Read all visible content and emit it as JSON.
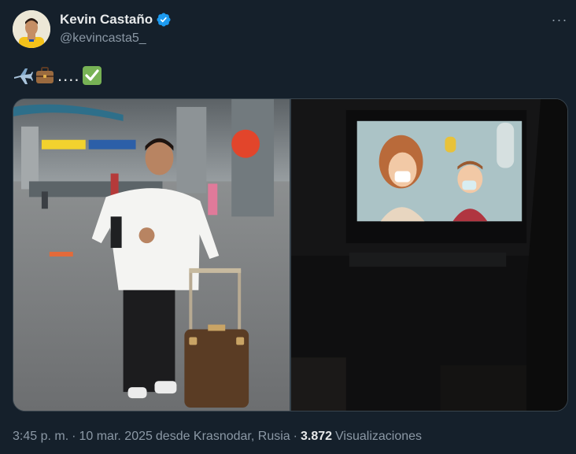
{
  "author": {
    "display_name": "Kevin Castaño",
    "handle": "@kevincasta5_",
    "verified": true,
    "avatar_icon": "avatar-photo"
  },
  "tweet": {
    "dots": "....",
    "emojis": [
      "airplane-emoji",
      "briefcase-emoji",
      "check-mark-emoji"
    ]
  },
  "media": [
    {
      "icon": "airport-photo"
    },
    {
      "icon": "in-flight-screen-photo"
    }
  ],
  "meta": {
    "time": "3:45 p. m.",
    "separator": "·",
    "date": "10 mar. 2025",
    "location_text": "desde Krasnodar, Rusia",
    "views_count": "3.872",
    "views_label": "Visualizaciones"
  },
  "colors": {
    "background": "#15202b",
    "verified": "#1d9bf0",
    "secondary_text": "#8b98a5"
  }
}
